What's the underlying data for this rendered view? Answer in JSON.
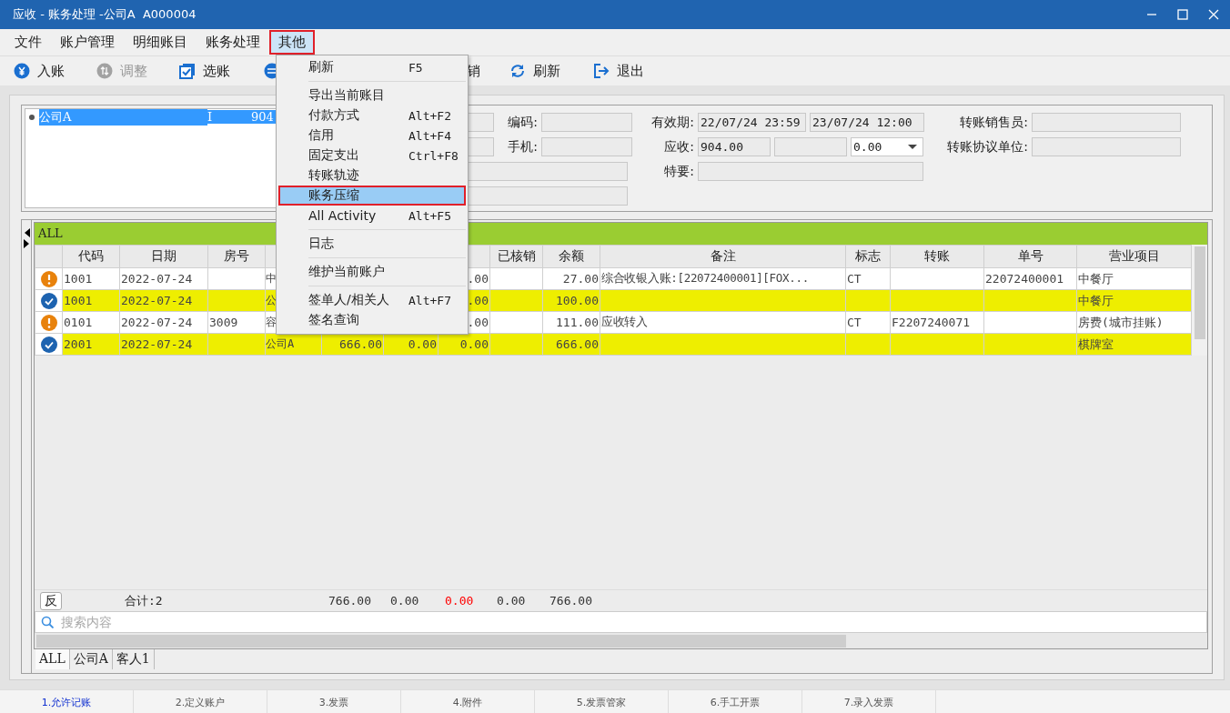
{
  "window": {
    "title": "应收 - 账务处理 -公司A  A000004"
  },
  "menu_bar": [
    {
      "label": "文件",
      "selected": false
    },
    {
      "label": "账户管理",
      "selected": false
    },
    {
      "label": "明细账目",
      "selected": false
    },
    {
      "label": "账务处理",
      "selected": false
    },
    {
      "label": "其他",
      "selected": true
    }
  ],
  "toolbar": [
    {
      "label": "入账",
      "disabled": false
    },
    {
      "label": "调整",
      "disabled": true
    },
    {
      "label": "选账",
      "disabled": false
    },
    {
      "disabled": false
    },
    {
      "label": "销"
    },
    {
      "label": "刷新",
      "disabled": false
    },
    {
      "label": "退出",
      "disabled": false
    }
  ],
  "dropdown_menu": [
    {
      "kind": "item",
      "label": "刷新",
      "shortcut": "F5",
      "selected": false
    },
    {
      "kind": "separator"
    },
    {
      "kind": "item",
      "label": "导出当前账目",
      "selected": false
    },
    {
      "kind": "item",
      "label": "付款方式",
      "shortcut": "Alt+F2",
      "selected": false
    },
    {
      "kind": "item",
      "label": "信用",
      "shortcut": "Alt+F4",
      "selected": false
    },
    {
      "kind": "item",
      "label": "固定支出",
      "shortcut": "Ctrl+F8",
      "selected": false
    },
    {
      "kind": "item",
      "label": "转账轨迹",
      "selected": false
    },
    {
      "kind": "item",
      "label": "账务压缩",
      "selected": true
    },
    {
      "kind": "item",
      "label": "All Activity",
      "shortcut": "Alt+F5",
      "selected": false
    },
    {
      "kind": "separator"
    },
    {
      "kind": "item",
      "label": "日志",
      "selected": false
    },
    {
      "kind": "separator"
    },
    {
      "kind": "item",
      "label": "维护当前账户",
      "selected": false
    },
    {
      "kind": "separator"
    },
    {
      "kind": "item",
      "label": "签单人/相关人",
      "shortcut": "Alt+F7",
      "selected": false
    },
    {
      "kind": "item",
      "label": "签名查询",
      "selected": false
    }
  ],
  "account_list": [
    {
      "name": "公司A",
      "type": "I",
      "amount": "904",
      "selected": true
    }
  ],
  "form": {
    "code_label": "编码:",
    "phone_label": "手机:",
    "validity_label": "有效期:",
    "validity_from": "22/07/24 23:59",
    "validity_to": "23/07/24 12:00",
    "receivable_label": "应收:",
    "receivable": "904.00",
    "receivable_option": "0.00",
    "special_label": "特要:",
    "salesperson_label": "转账销售员:",
    "agreement_unit_label": "转账协议单位:"
  },
  "grid": {
    "group": "ALL",
    "columns": [
      null,
      "代码",
      "日期",
      "房号",
      null,
      null,
      null,
      null,
      "已核销",
      "余额",
      "备注",
      "标志",
      "转账",
      "单号",
      "营业项目"
    ],
    "rows": [
      {
        "kind": "warning",
        "highlighted": false,
        "cells": [
          null,
          "1001",
          "2022-07-24",
          null,
          "中",
          null,
          null,
          ".00",
          null,
          "27.00",
          "综合收银入账:[22072400001][FOX...",
          "CT",
          null,
          "22072400001",
          "中餐厅"
        ]
      },
      {
        "kind": "done",
        "highlighted": true,
        "cells": [
          null,
          "1001",
          "2022-07-24",
          null,
          "公",
          null,
          null,
          ".00",
          null,
          "100.00",
          null,
          null,
          null,
          null,
          "中餐厅"
        ]
      },
      {
        "kind": "warning",
        "highlighted": false,
        "cells": [
          null,
          "0101",
          "2022-07-24",
          "3009",
          "容",
          null,
          null,
          ".00",
          null,
          "111.00",
          "应收转入",
          "CT",
          "F2207240071",
          null,
          "房费(城市挂账)"
        ]
      },
      {
        "kind": "done",
        "highlighted": true,
        "cells": [
          null,
          "2001",
          "2022-07-24",
          null,
          "公司A",
          "666.00",
          "0.00",
          "0.00",
          null,
          "666.00",
          null,
          null,
          null,
          null,
          "棋牌室"
        ]
      }
    ],
    "reverse_button": "反",
    "total_label": "合计:2",
    "totals": [
      {
        "text": "766.00",
        "color": "#333333"
      },
      {
        "text": "0.00",
        "color": "#333333"
      },
      {
        "text": "0.00",
        "color": "#ff0000"
      },
      {
        "text": "0.00",
        "color": "#333333"
      },
      {
        "text": "766.00",
        "color": "#333333"
      }
    ],
    "search": {
      "placeholder": "搜索内容"
    },
    "tabs": [
      {
        "label": "ALL",
        "selected": true
      },
      {
        "label": "公司A",
        "selected": false
      },
      {
        "label": "客人1",
        "selected": false
      }
    ]
  },
  "status_tabs": [
    {
      "label": "1.允许记账",
      "selected": true
    },
    {
      "label": "2.定义账户",
      "selected": false
    },
    {
      "label": "3.发票",
      "selected": false
    },
    {
      "label": "4.附件",
      "selected": false
    },
    {
      "label": "5.发票管家",
      "selected": false
    },
    {
      "label": "6.手工开票",
      "selected": false
    },
    {
      "label": "7.录入发票",
      "selected": false
    }
  ]
}
